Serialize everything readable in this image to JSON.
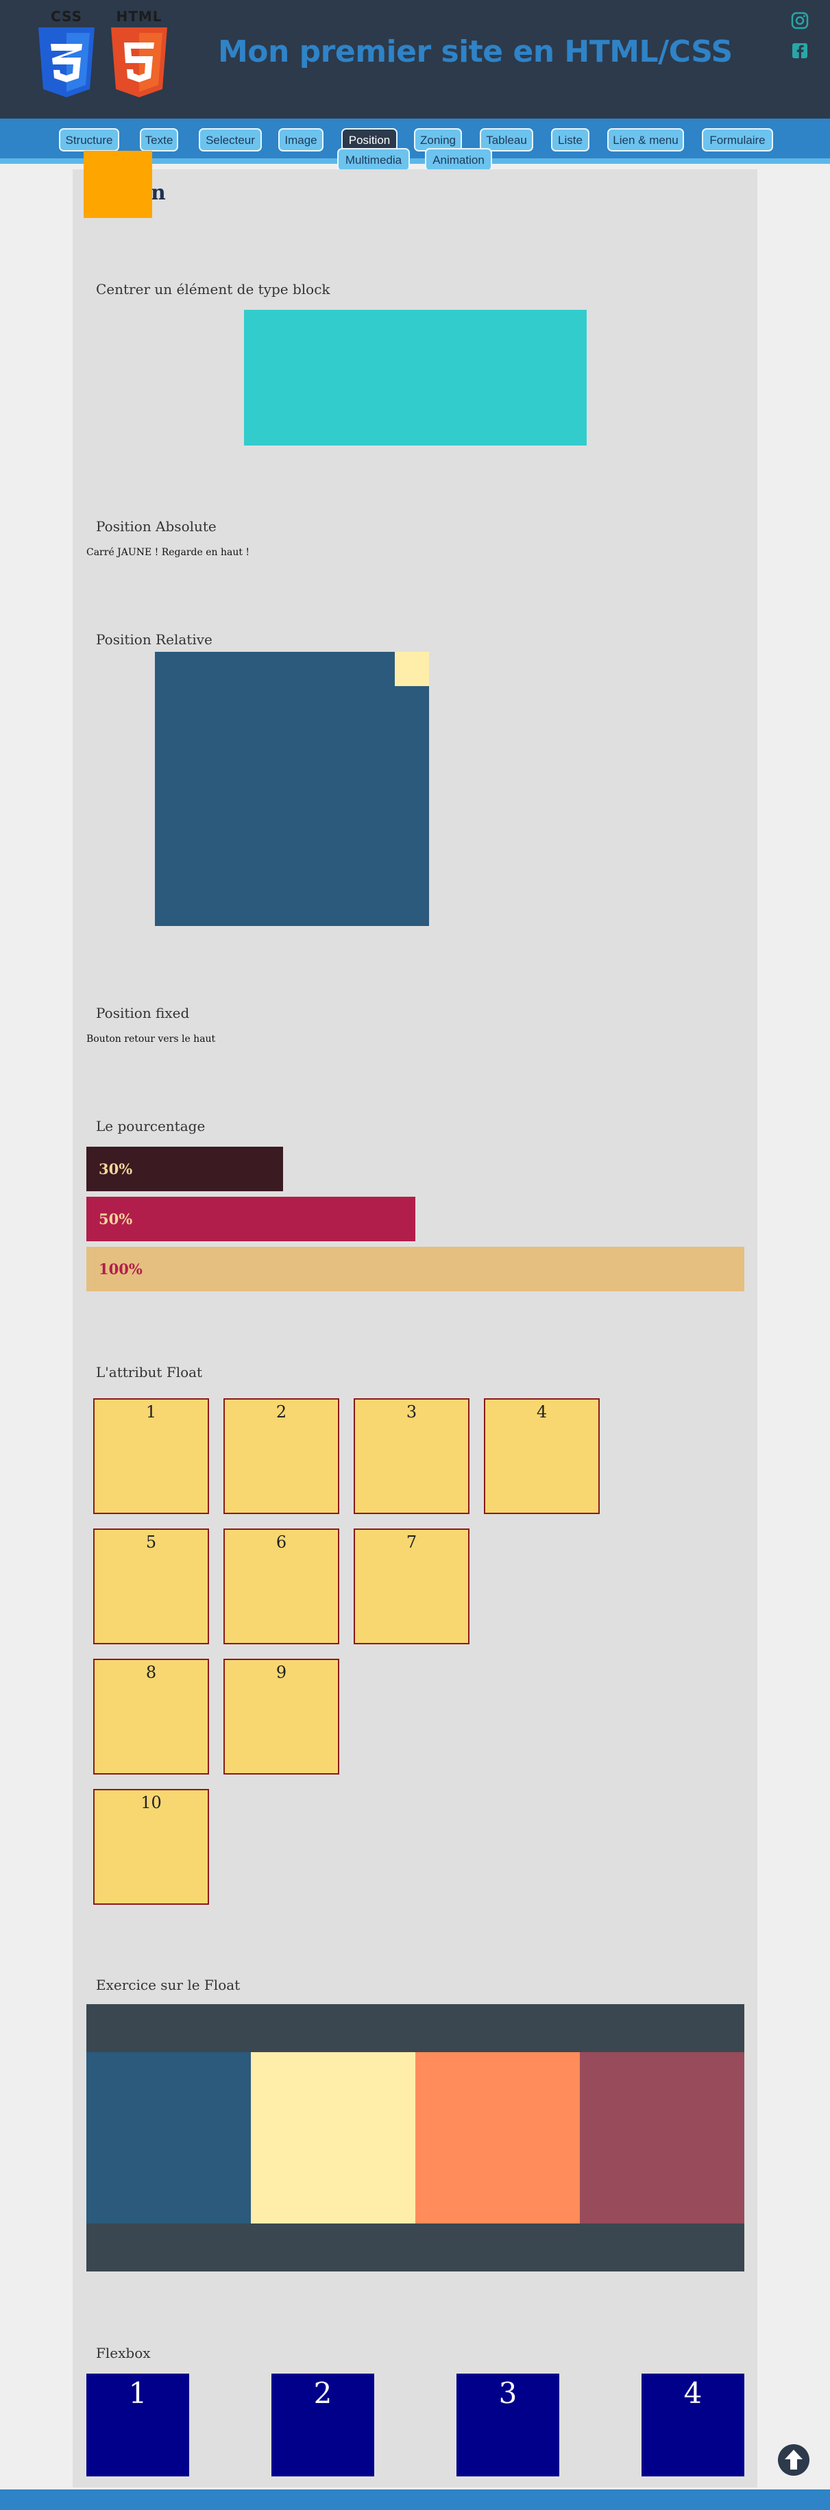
{
  "header": {
    "css_logo_text": "CSS",
    "html_logo_text": "HTML",
    "title": "Mon premier site en HTML/CSS",
    "social": [
      "instagram-icon",
      "facebook-icon"
    ]
  },
  "nav": {
    "items": [
      "Structure",
      "Texte",
      "Selecteur",
      "Image",
      "Position",
      "Zoning",
      "Tableau",
      "Liste",
      "Lien & menu",
      "Formulaire"
    ],
    "submenu": [
      "Multimedia",
      "Animation"
    ],
    "active": "Position"
  },
  "main": {
    "heading_visible": "on",
    "sections": {
      "block_center": "Centrer un élément de type block",
      "absolute": "Position Absolute",
      "absolute_note": "Carré JAUNE ! Regarde en haut !",
      "relative": "Position Relative",
      "fixed": "Position fixed",
      "fixed_note": "Bouton retour vers le haut",
      "percentage": "Le pourcentage",
      "float": "L'attribut Float",
      "float_exercise": "Exercice sur le Float",
      "flexbox": "Flexbox"
    },
    "percent_bars": [
      {
        "label": "30%",
        "value": 30,
        "bg": "#3b1a22",
        "fg": "#f2d59a"
      },
      {
        "label": "50%",
        "value": 50,
        "bg": "#b21e4b",
        "fg": "#f2d59a"
      },
      {
        "label": "100%",
        "value": 100,
        "bg": "#e4bf80",
        "fg": "#b21e4b"
      }
    ],
    "float_boxes": [
      "1",
      "2",
      "3",
      "4",
      "5",
      "6",
      "7",
      "8",
      "9",
      "10"
    ],
    "float_exercise_colors": [
      "#2b5a7c",
      "#ffeeaa",
      "#ff8c5a",
      "#984b5a"
    ],
    "flex_boxes": [
      "1",
      "2",
      "3",
      "4"
    ]
  },
  "colors": {
    "header_bg": "#2c3a4b",
    "accent": "#2f83c7",
    "nav_button": "#6cc3ee",
    "content_bg": "#dfdfdf",
    "orange_square": "#ffa500"
  }
}
